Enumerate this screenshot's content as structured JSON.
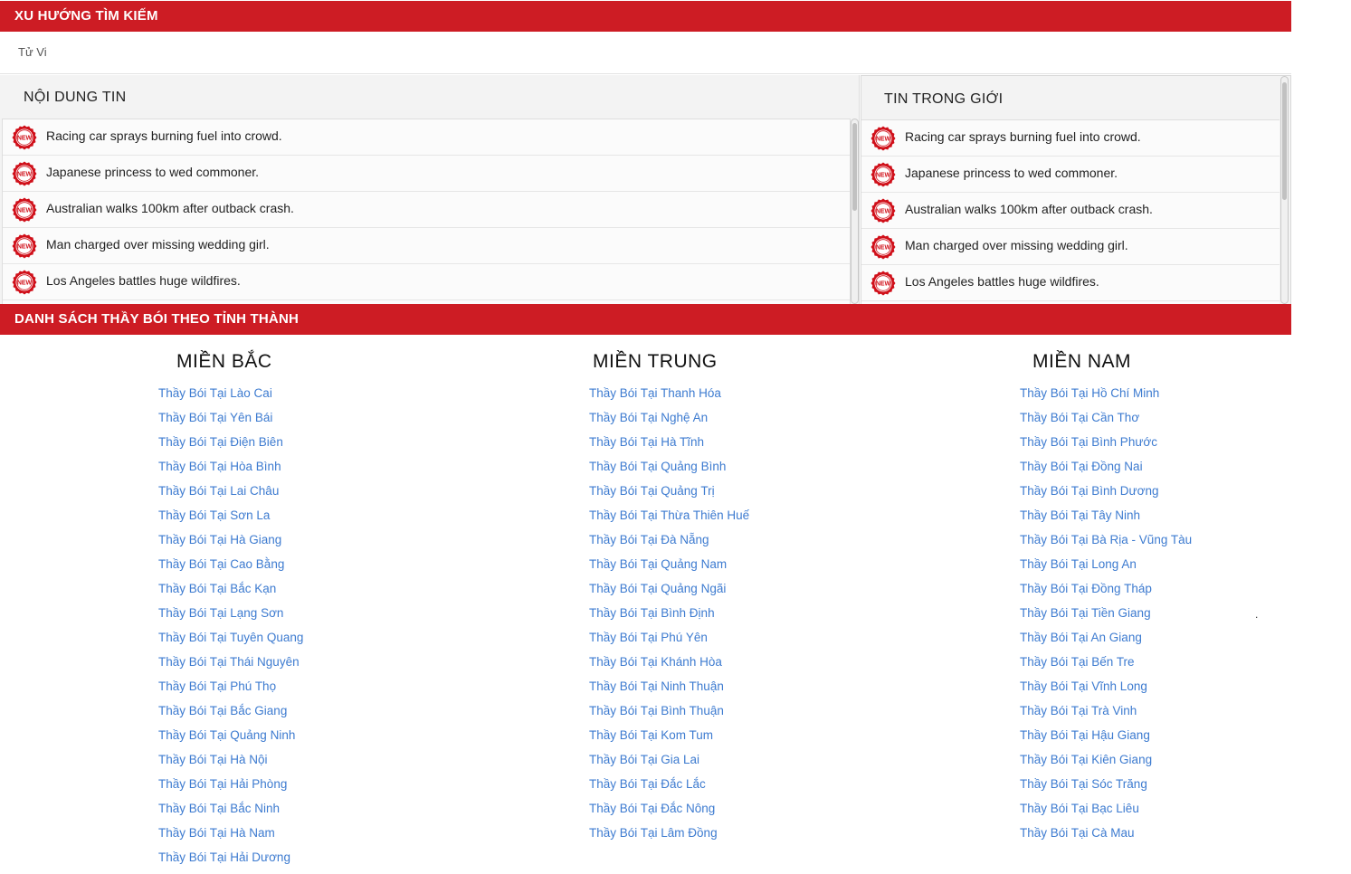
{
  "trending": {
    "title": "XU HƯỚNG TÌM KIẾM",
    "tag": "Tử Vi"
  },
  "news_left": {
    "title": "NỘI DUNG TIN",
    "items": [
      "Racing car sprays burning fuel into crowd.",
      "Japanese princess to wed commoner.",
      "Australian walks 100km after outback crash.",
      "Man charged over missing wedding girl.",
      "Los Angeles battles huge wildfires."
    ]
  },
  "news_right": {
    "title": "TIN TRONG GIỚI",
    "items": [
      "Racing car sprays burning fuel into crowd.",
      "Japanese princess to wed commoner.",
      "Australian walks 100km after outback crash.",
      "Man charged over missing wedding girl.",
      "Los Angeles battles huge wildfires."
    ]
  },
  "new_badge": {
    "text": "NEW",
    "color": "#d0101a",
    "icon": "new-badge-icon"
  },
  "directory": {
    "title": "DANH SÁCH THẦY BÓI THEO TỈNH THÀNH",
    "regions": [
      {
        "name": "MIỀN BẮC",
        "links": [
          "Thầy Bói Tại Lào Cai",
          "Thầy Bói Tại Yên Bái",
          "Thầy Bói Tại Điện Biên",
          "Thầy Bói Tại Hòa Bình",
          "Thầy Bói Tại Lai Châu",
          "Thầy Bói Tại Sơn La",
          "Thầy Bói Tại Hà Giang",
          "Thầy Bói Tại Cao Bằng",
          "Thầy Bói Tại Bắc Kạn",
          "Thầy Bói Tại Lạng Sơn",
          "Thầy Bói Tại Tuyên Quang",
          "Thầy Bói Tại Thái Nguyên",
          "Thầy Bói Tại Phú Thọ",
          "Thầy Bói Tại Bắc Giang",
          "Thầy Bói Tại Quảng Ninh",
          "Thầy Bói Tại Hà Nội",
          "Thầy Bói Tại Hải Phòng",
          "Thầy Bói Tại Bắc Ninh",
          "Thầy Bói Tại Hà Nam",
          "Thầy Bói Tại Hải Dương"
        ]
      },
      {
        "name": "MIỀN TRUNG",
        "links": [
          "Thầy Bói Tại Thanh Hóa",
          "Thầy Bói Tại Nghệ An",
          "Thầy Bói Tại Hà Tĩnh",
          "Thầy Bói Tại Quảng Bình",
          "Thầy Bói Tại Quảng Trị",
          "Thầy Bói Tại Thừa Thiên Huế",
          "Thầy Bói Tại Đà Nẵng",
          "Thầy Bói Tại Quảng Nam",
          "Thầy Bói Tại Quảng Ngãi",
          "Thầy Bói Tại Bình Định",
          "Thầy Bói Tại Phú Yên",
          "Thầy Bói Tại Khánh Hòa",
          "Thầy Bói Tại Ninh Thuận",
          "Thầy Bói Tại Bình Thuận",
          "Thầy Bói Tại Kom Tum",
          "Thầy Bói Tại Gia Lai",
          "Thầy Bói Tại Đắc Lắc",
          "Thầy Bói Tại Đắc Nông",
          "Thầy Bói Tại Lâm Đồng"
        ]
      },
      {
        "name": "MIỀN NAM",
        "links": [
          "Thầy Bói Tại Hồ Chí Minh",
          "Thầy Bói Tại Cần Thơ",
          "Thầy Bói Tại Bình Phước",
          "Thầy Bói Tại Đồng Nai",
          "Thầy Bói Tại Bình Dương",
          "Thầy Bói Tại Tây Ninh",
          "Thầy Bói Tại Bà Rịa - Vũng Tàu",
          "Thầy Bói Tại Long An",
          "Thầy Bói Tại Đồng Tháp",
          "Thầy Bói Tại Tiền Giang",
          "Thầy Bói Tại An Giang",
          "Thầy Bói Tại Bến Tre",
          "Thầy Bói Tại Vĩnh Long",
          "Thầy Bói Tại Trà Vinh",
          "Thầy Bói Tại Hậu Giang",
          "Thầy Bói Tại Kiên Giang",
          "Thầy Bói Tại Sóc Trăng",
          "Thầy Bói Tại Bạc Liêu",
          "Thầy Bói Tại Cà Mau"
        ]
      }
    ]
  },
  "colors": {
    "brand_red": "#cd1c24",
    "link_blue": "#3d7bd0"
  }
}
